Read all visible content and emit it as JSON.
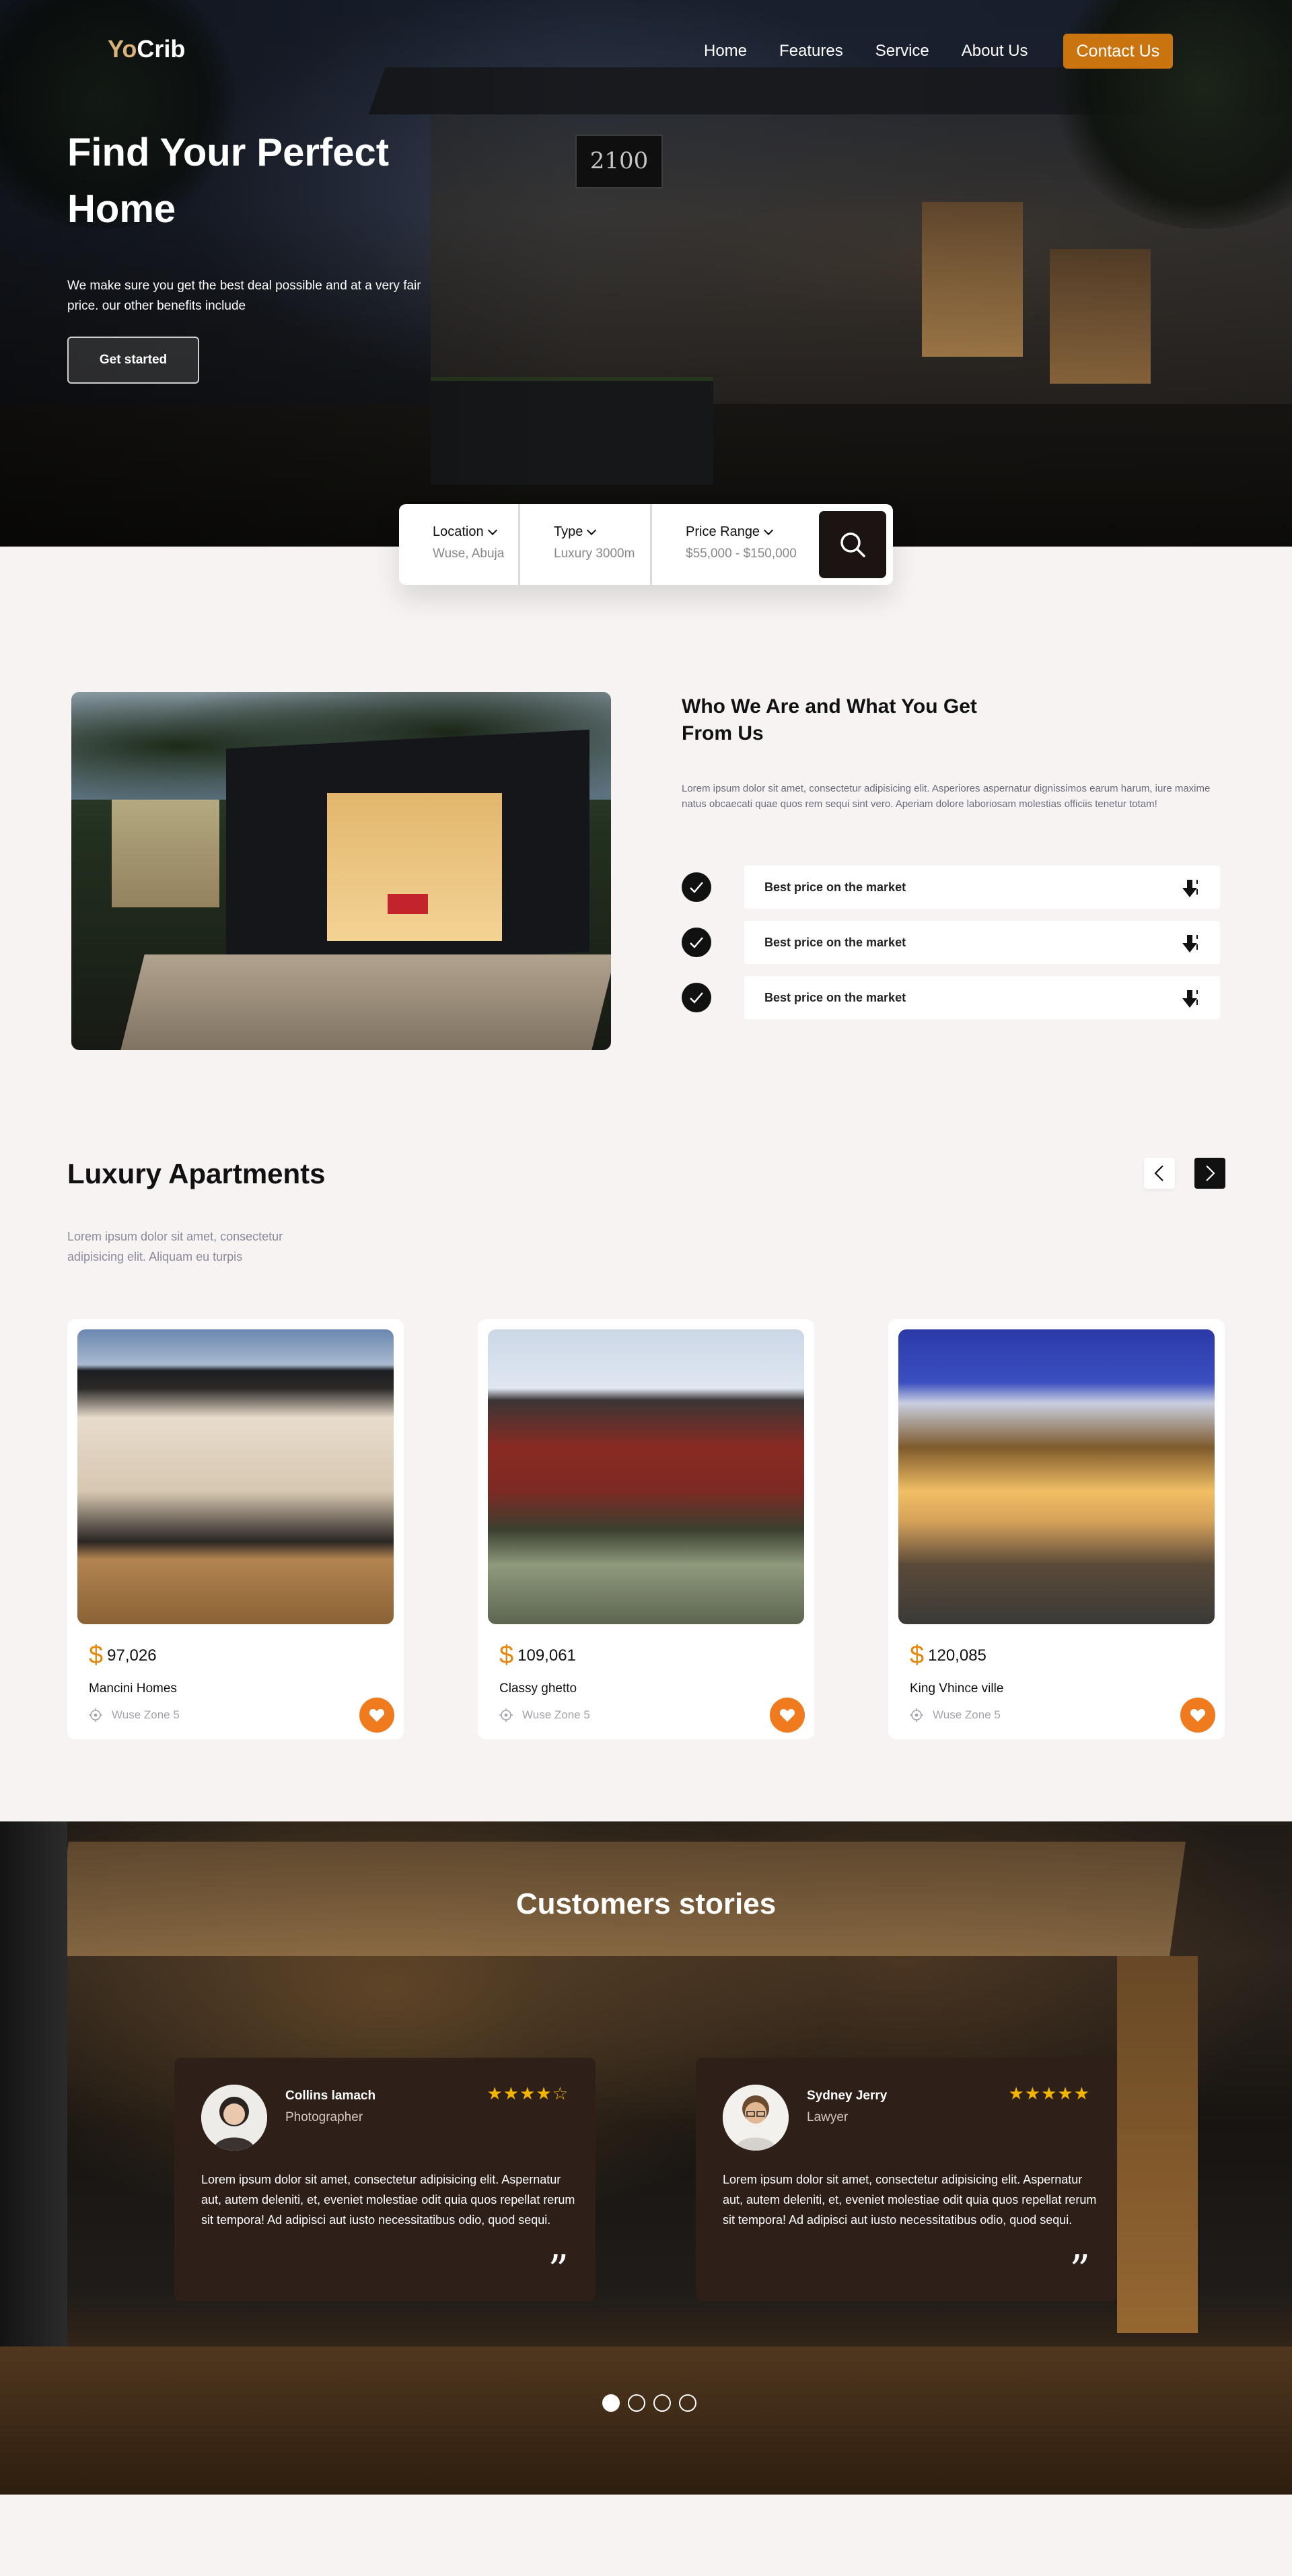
{
  "brand": {
    "logo_prefix": "Yo",
    "logo_suffix": "Crib"
  },
  "nav": {
    "items": [
      "Home",
      "Features",
      "Service",
      "About Us"
    ],
    "contact": "Contact Us"
  },
  "hero": {
    "title": "Find Your Perfect Home",
    "subtitle": "We make sure you get the best deal possible and at a very fair price. our other benefits include",
    "cta": "Get started",
    "sign": "2100"
  },
  "search": {
    "fields": [
      {
        "label": "Location",
        "value": "Wuse, Abuja"
      },
      {
        "label": "Type",
        "value": "Luxury 3000m"
      },
      {
        "label": "Price Range",
        "value": "$55,000 - $150,000"
      }
    ],
    "button_icon": "search-icon"
  },
  "about": {
    "title": "Who We Are and What You Get From Us",
    "text": "Lorem ipsum dolor sit amet, consectetur adipisicing elit. Asperiores aspernatur dignissimos earum harum, iure maxime natus obcaecati quae quos rem sequi sint vero. Aperiam dolore laboriosam molestias officiis tenetur totam!",
    "features": [
      "Best price on the market",
      "Best price on the market",
      "Best price on the market"
    ]
  },
  "luxury": {
    "title": "Luxury Apartments",
    "subtitle": "Lorem ipsum dolor sit amet, consectetur adipisicing elit. Aliquam eu turpis",
    "apartments": [
      {
        "currency": "$",
        "price": "97,026",
        "name": "Mancini Homes",
        "location": "Wuse Zone 5"
      },
      {
        "currency": "$",
        "price": "109,061",
        "name": "Classy ghetto",
        "location": "Wuse Zone 5"
      },
      {
        "currency": "$",
        "price": "120,085",
        "name": "King Vhince ville",
        "location": "Wuse Zone 5"
      }
    ]
  },
  "stories": {
    "title": "Customers stories",
    "reviews": [
      {
        "name": "Collins lamach",
        "role": "Photographer",
        "stars": "★★★★☆",
        "rating": 4,
        "text": "Lorem ipsum dolor sit amet, consectetur adipisicing elit. Aspernatur aut, autem deleniti, et, eveniet molestiae odit quia quos repellat rerum sit tempora! Ad adipisci aut iusto necessitatibus odio, quod sequi.",
        "quote": "”"
      },
      {
        "name": "Sydney Jerry",
        "role": "Lawyer",
        "stars": "★★★★★",
        "rating": 5,
        "text": "Lorem ipsum dolor sit amet, consectetur adipisicing elit. Aspernatur aut, autem deleniti, et, eveniet molestiae odit quia quos repellat rerum sit tempora! Ad adipisci aut iusto necessitatibus odio, quod sequi.",
        "quote": "”"
      }
    ],
    "carousel_count": 4,
    "carousel_active": 1
  },
  "colors": {
    "accent": "#c9740f",
    "orange": "#f07a1e",
    "dark": "#1c1412",
    "star": "#f2b400"
  }
}
